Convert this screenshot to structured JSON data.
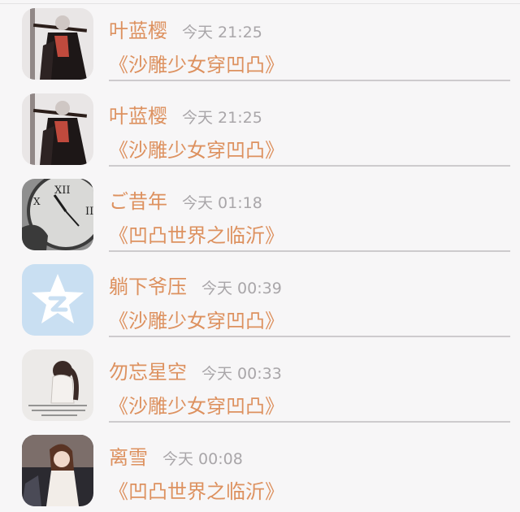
{
  "feed": {
    "items": [
      {
        "avatar": "avatar-icon",
        "name": "叶蓝樱",
        "time": "今天 21:25",
        "message": "《沙雕少女穿凹凸》"
      },
      {
        "avatar": "avatar-icon",
        "name": "叶蓝樱",
        "time": "今天 21:25",
        "message": "《沙雕少女穿凹凸》"
      },
      {
        "avatar": "clock-icon",
        "name": "ご昔年",
        "time": "今天 01:18",
        "message": "《凹凸世界之临沂》"
      },
      {
        "avatar": "qzone-star-icon",
        "name": "躺下爷压",
        "time": "今天 00:39",
        "message": "《沙雕少女穿凹凸》"
      },
      {
        "avatar": "avatar-icon",
        "name": "勿忘星空",
        "time": "今天 00:33",
        "message": "《沙雕少女穿凹凸》"
      },
      {
        "avatar": "avatar-icon",
        "name": "离雪",
        "time": "今天 00:08",
        "message": "《凹凸世界之临沂》"
      }
    ]
  },
  "colors": {
    "accent": "#dd915f",
    "time_gray": "#a9a6a9",
    "background": "#f7f6f7",
    "divider": "#cdcbcd"
  }
}
